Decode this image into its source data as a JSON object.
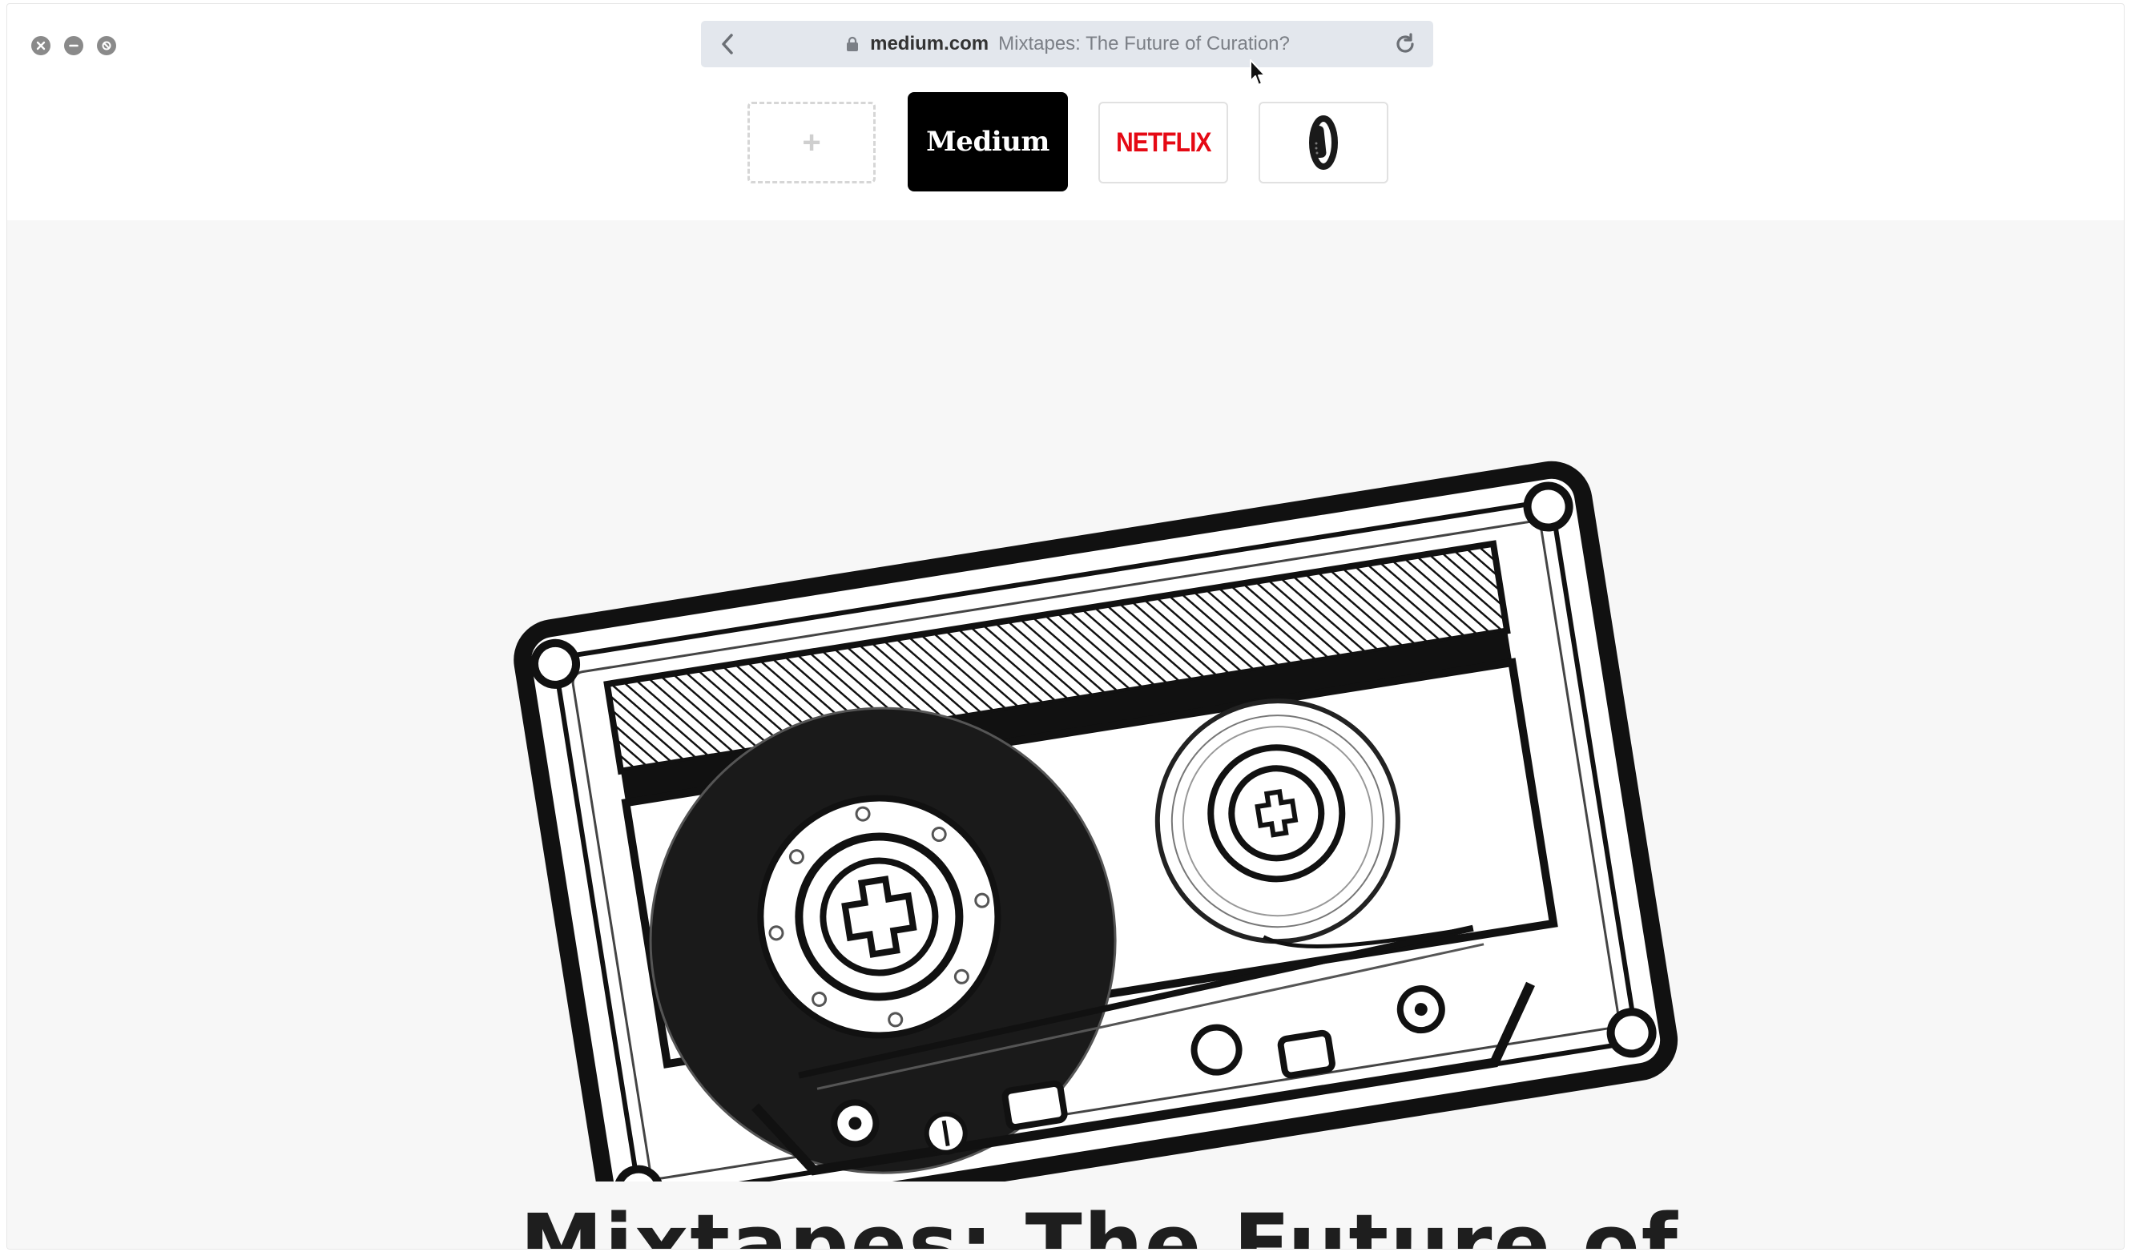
{
  "browser": {
    "window_controls": [
      "close-icon",
      "minimize-icon",
      "fullscreen-icon"
    ],
    "address_bar": {
      "domain": "medium.com",
      "page_title": "Mixtapes: The Future of Curation?",
      "back_icon": "chevron-left-icon",
      "lock_icon": "lock-icon",
      "reload_icon": "reload-icon"
    }
  },
  "favorites": {
    "add_label": "+",
    "items": [
      {
        "label": "Medium",
        "bg": "#000000",
        "fg": "#ffffff"
      },
      {
        "label": "NETFLIX",
        "fg": "#e50914"
      },
      {
        "label": "",
        "icon": "fitbit-band-icon"
      }
    ]
  },
  "article": {
    "hero_image": "cassette-tape-illustration",
    "title_visible": "Mixtapes: The Future of"
  },
  "colors": {
    "address_bar_bg": "#e3e7ed",
    "content_bg": "#f7f7f7",
    "netflix_red": "#e50914"
  }
}
